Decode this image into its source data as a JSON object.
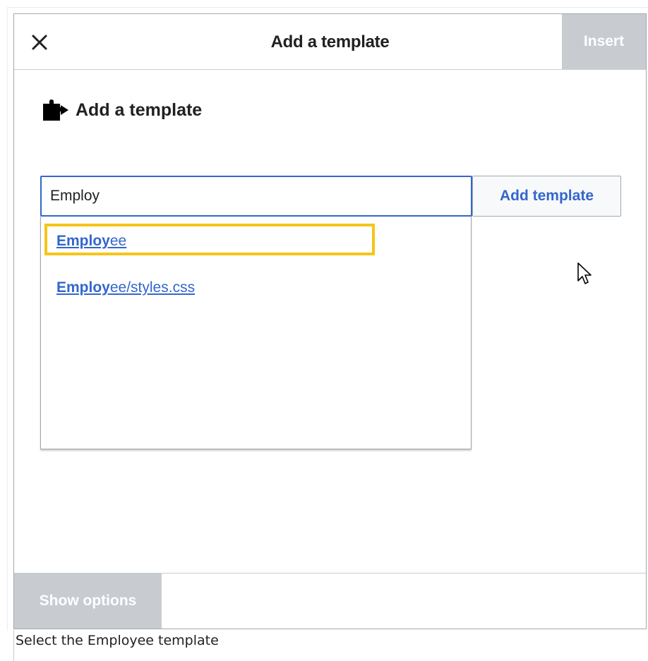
{
  "dialog": {
    "title": "Add a template",
    "insert_label": "Insert",
    "close_icon": "close-icon",
    "show_options_label": "Show options"
  },
  "section": {
    "icon": "puzzle-icon",
    "title": "Add a template"
  },
  "search": {
    "value": "Employ",
    "add_button_label": "Add template"
  },
  "suggestions": [
    {
      "match": "Employ",
      "rest": "ee",
      "selected": true
    },
    {
      "match": "Employ",
      "rest": "ee/styles.css",
      "selected": false
    }
  ],
  "caption": "Select the Employee template",
  "colors": {
    "accent": "#3366cc",
    "highlight": "#f5c518",
    "disabled": "#c8ccd1"
  }
}
